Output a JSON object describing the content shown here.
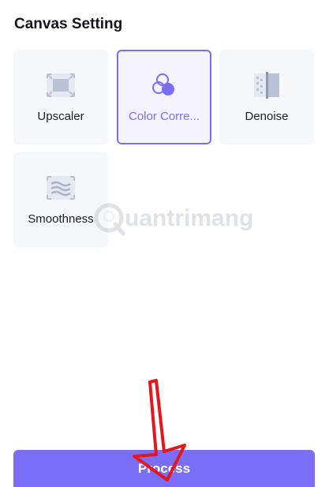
{
  "header": {
    "title": "Canvas Setting"
  },
  "options": [
    {
      "label": "Upscaler",
      "icon": "upscale-icon",
      "selected": false
    },
    {
      "label": "Color Corre...",
      "icon": "color-circles-icon",
      "selected": true
    },
    {
      "label": "Denoise",
      "icon": "denoise-icon",
      "selected": false
    },
    {
      "label": "Smoothness",
      "icon": "waves-icon",
      "selected": false
    }
  ],
  "footer": {
    "process_label": "Process"
  },
  "colors": {
    "accent": "#7b6ef6",
    "icon_gray": "#b9c1d6",
    "arrow_red": "#e5161e"
  },
  "watermark": {
    "text": "uantrimang"
  }
}
